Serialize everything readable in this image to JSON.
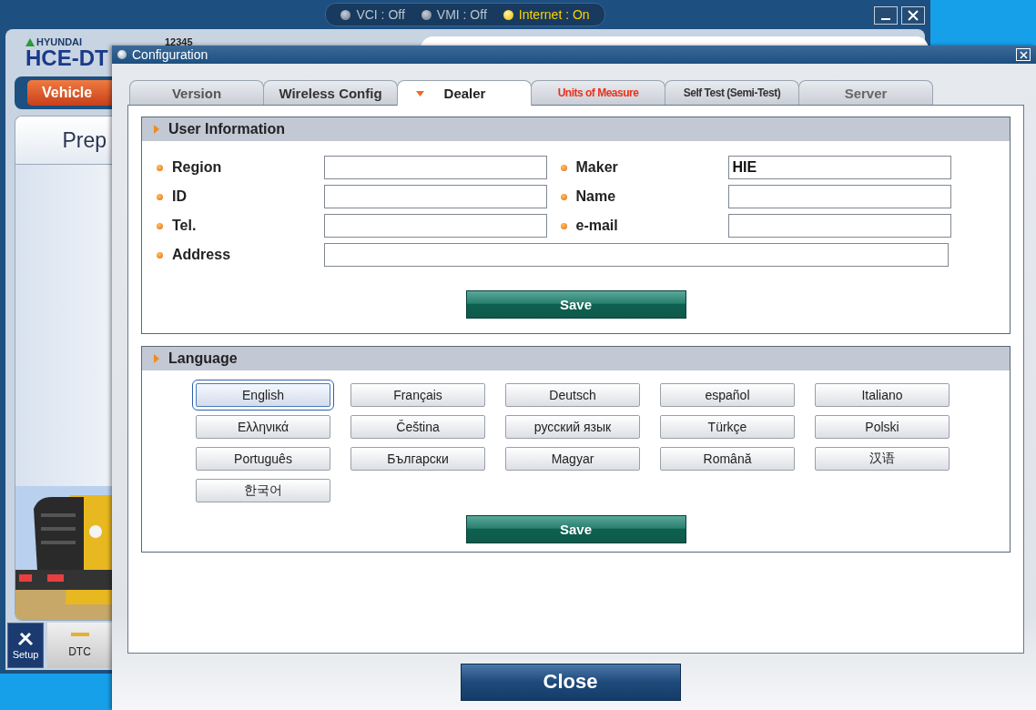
{
  "background_window": {
    "status": [
      {
        "label": "VCI : Off",
        "on": false
      },
      {
        "label": "VMI : Off",
        "on": false
      },
      {
        "label": "Internet : On",
        "on": true
      }
    ],
    "logo": {
      "brand": "HYUNDAI",
      "product": "HCE-DT"
    },
    "serial": "12345",
    "vehicle_button": "Vehicle",
    "panel_title": "Prep",
    "bottom_buttons": [
      {
        "label": "Setup",
        "kind": "icon"
      },
      {
        "label": "DTC",
        "kind": "indicator"
      }
    ]
  },
  "dialog": {
    "title": "Configuration",
    "tabs": [
      {
        "label": "Version",
        "selected": false,
        "color": "#555555",
        "kind": "normal"
      },
      {
        "label": "Wireless Config",
        "selected": false,
        "color": "#333333",
        "kind": "normal"
      },
      {
        "label": "Dealer",
        "selected": true,
        "color": "#222222",
        "kind": "normal"
      },
      {
        "label": "Units of Measure",
        "selected": false,
        "color": "#e8321e",
        "kind": "narrow"
      },
      {
        "label": "Self Test (Semi-Test)",
        "selected": false,
        "color": "#333333",
        "kind": "narrow"
      },
      {
        "label": "Server",
        "selected": false,
        "color": "#666666",
        "kind": "normal"
      }
    ],
    "user_information": {
      "title": "User Information",
      "fields": [
        {
          "label": "Region",
          "kind": "short"
        },
        {
          "label": "Maker",
          "kind": "short",
          "value": "HIE"
        },
        {
          "label": "ID",
          "kind": "short"
        },
        {
          "label": "Name",
          "kind": "short"
        },
        {
          "label": "Tel.",
          "kind": "short"
        },
        {
          "label": "e-mail",
          "kind": "short"
        },
        {
          "label": "Address",
          "kind": "wide"
        }
      ],
      "save": "Save"
    },
    "language": {
      "title": "Language",
      "options": [
        {
          "label": "English",
          "selected": true
        },
        {
          "label": "Français",
          "selected": false
        },
        {
          "label": "Deutsch",
          "selected": false
        },
        {
          "label": "español",
          "selected": false
        },
        {
          "label": "Italiano",
          "selected": false
        },
        {
          "label": "Ελληνικά",
          "selected": false
        },
        {
          "label": "Čeština",
          "selected": false
        },
        {
          "label": "русский язык",
          "selected": false
        },
        {
          "label": "Türkçe",
          "selected": false
        },
        {
          "label": "Polski",
          "selected": false
        },
        {
          "label": "Português",
          "selected": false
        },
        {
          "label": "Български",
          "selected": false
        },
        {
          "label": "Magyar",
          "selected": false
        },
        {
          "label": "Română",
          "selected": false
        },
        {
          "label": "汉语",
          "selected": false
        },
        {
          "label": "한국어",
          "selected": false
        }
      ],
      "save": "Save"
    },
    "close": "Close"
  }
}
